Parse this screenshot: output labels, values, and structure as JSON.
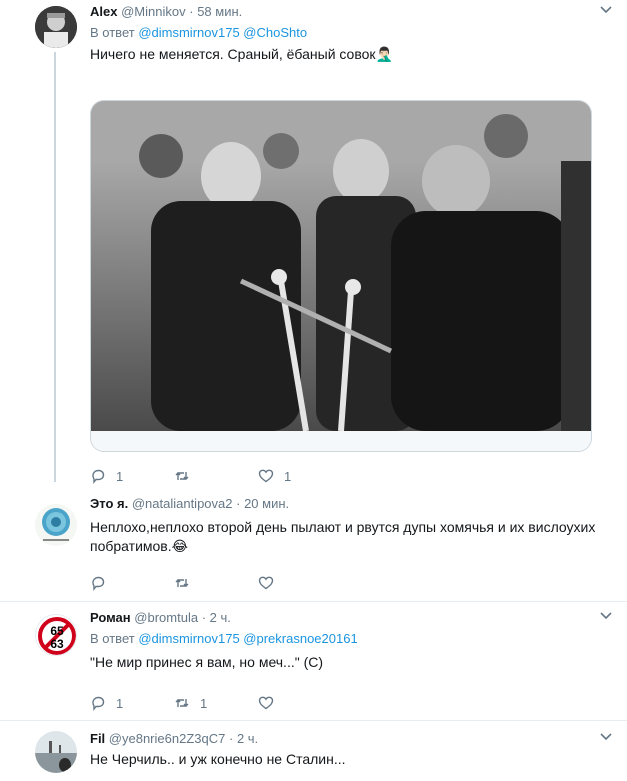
{
  "tweets": [
    {
      "name": "Alex",
      "handle": "@Minnikov",
      "time": "58 мин.",
      "reply_prefix": "В ответ",
      "reply_users": [
        "@dimsmirnov175",
        "@ChoShto"
      ],
      "text": "Ничего не меняется. Сраный, ёбаный совок🤦🏻‍♂️",
      "reply_count": "1",
      "retweet_count": "",
      "like_count": "1"
    },
    {
      "name": "Это я.",
      "handle": "@nataliantipova2",
      "time": "20 мин.",
      "text": "Неплохо,неплохо второй день пылают и рвутся дупы хомячья и их вислоухих побратимов.😂",
      "reply_count": "",
      "retweet_count": "",
      "like_count": ""
    },
    {
      "name": "Роман",
      "handle": "@bromtula",
      "time": "2 ч.",
      "avatar_text_top": "65",
      "avatar_text_bottom": "63",
      "reply_prefix": "В ответ",
      "reply_users": [
        "@dimsmirnov175",
        "@prekrasnoe20161"
      ],
      "text": "\"Не мир принес я вам, но меч...\" (С)",
      "reply_count": "1",
      "retweet_count": "1",
      "like_count": ""
    },
    {
      "name": "Fil",
      "handle": "@ye8nrie6n2Z3qC7",
      "time": "2 ч.",
      "text": "Не Черчиль.. и уж конечно не Сталин..."
    }
  ],
  "separator": "·",
  "colors": {
    "accent": "#1b95e0",
    "muted": "#657786",
    "divider": "#e6ecf0",
    "reaction_pink": "#e0245e"
  }
}
